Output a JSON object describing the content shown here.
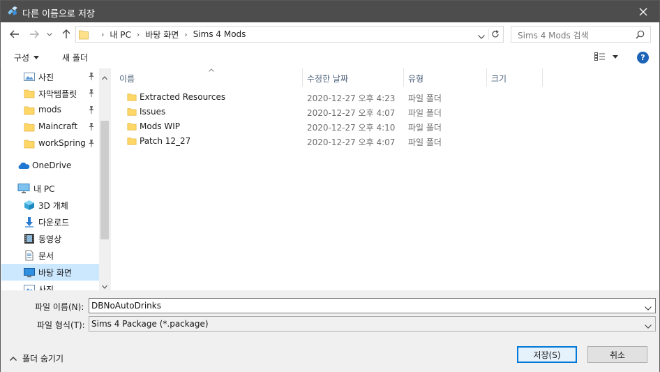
{
  "window": {
    "title": "다른 이름으로 저장"
  },
  "address": {
    "crumbs": [
      "내 PC",
      "바탕 화면",
      "Sims 4 Mods"
    ],
    "search_placeholder": "Sims 4 Mods 검색"
  },
  "toolbar": {
    "organize": "구성",
    "new_folder": "새 폴더",
    "help": "?"
  },
  "nav": {
    "items": [
      {
        "label": "사진",
        "icon": "pictures-icon",
        "pinned": true
      },
      {
        "label": "자막템플릿",
        "icon": "folder-icon",
        "pinned": true
      },
      {
        "label": "mods",
        "icon": "folder-icon",
        "pinned": true
      },
      {
        "label": "Maincraft",
        "icon": "folder-icon",
        "pinned": true
      },
      {
        "label": "workSpring",
        "icon": "folder-icon",
        "pinned": true
      },
      {
        "label": "OneDrive",
        "icon": "onedrive-icon",
        "pinned": false
      },
      {
        "label": "내 PC",
        "icon": "pc-icon",
        "pinned": false
      },
      {
        "label": "3D 개체",
        "icon": "3d-objects-icon",
        "pinned": false
      },
      {
        "label": "다운로드",
        "icon": "download-icon",
        "pinned": false
      },
      {
        "label": "동영상",
        "icon": "video-icon",
        "pinned": false
      },
      {
        "label": "문서",
        "icon": "documents-icon",
        "pinned": false
      },
      {
        "label": "바탕 화면",
        "icon": "desktop-icon",
        "pinned": false,
        "selected": true
      },
      {
        "label": "사진",
        "icon": "pictures-icon",
        "pinned": false
      }
    ]
  },
  "columns": {
    "name": "이름",
    "modified": "수정한 날짜",
    "type": "유형",
    "size": "크기"
  },
  "files": [
    {
      "name": "Extracted Resources",
      "modified": "2020-12-27 오후 4:23",
      "type": "파일 폴더"
    },
    {
      "name": "Issues",
      "modified": "2020-12-27 오후 4:07",
      "type": "파일 폴더"
    },
    {
      "name": "Mods WIP",
      "modified": "2020-12-27 오후 4:10",
      "type": "파일 폴더"
    },
    {
      "name": "Patch 12_27",
      "modified": "2020-12-27 오후 4:07",
      "type": "파일 폴더"
    }
  ],
  "form": {
    "filename_label": "파일 이름(N):",
    "filename_value": "DBNoAutoDrinks",
    "filetype_label": "파일 형식(T):",
    "filetype_value": "Sims 4 Package (*.package)",
    "hide_folders": "폴더 숨기기",
    "save": "저장(S)",
    "cancel": "취소"
  },
  "colors": {
    "titlebar": "#4d4d4d",
    "selection": "#cce8ff",
    "folder": "#ffd766",
    "accent": "#0078d7"
  }
}
